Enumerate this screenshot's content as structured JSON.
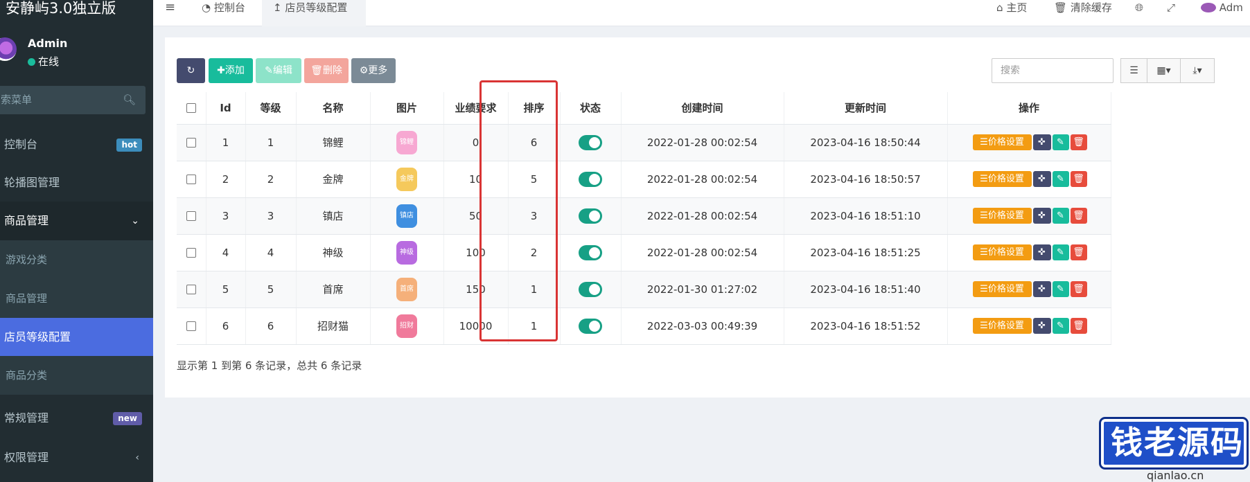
{
  "app": {
    "title": "安静屿3.0独立版"
  },
  "user": {
    "name": "Admin",
    "status": "在线"
  },
  "sidebar": {
    "search_placeholder": "索菜单",
    "items": [
      {
        "label": "控制台",
        "badge": "hot"
      },
      {
        "label": "轮播图管理"
      },
      {
        "label": "商品管理"
      },
      {
        "label": "游戏分类"
      },
      {
        "label": "商品管理"
      },
      {
        "label": "店员等级配置"
      },
      {
        "label": "商品分类"
      },
      {
        "label": "常规管理",
        "badge": "new"
      },
      {
        "label": "权限管理"
      }
    ]
  },
  "topbar": {
    "menu_icon": "≡",
    "tab_dashboard": "控制台",
    "tab_current": "店员等级配置",
    "home": "主页",
    "clear_cache": "清除缓存",
    "admin": "Adm"
  },
  "toolbar": {
    "add": "添加",
    "edit": "编辑",
    "delete": "删除",
    "more": "更多",
    "search_placeholder": "搜索"
  },
  "table": {
    "headers": [
      "Id",
      "等级",
      "名称",
      "图片",
      "业绩要求",
      "排序",
      "状态",
      "创建时间",
      "更新时间",
      "操作"
    ],
    "price_label": "价格设置",
    "rows": [
      {
        "id": "1",
        "level": "1",
        "name": "锦鲤",
        "img_text": "锦鲤",
        "img_color": "#f7a8d2",
        "perf": "0",
        "sort": "6",
        "created": "2022-01-28 00:02:54",
        "updated": "2023-04-16 18:50:44"
      },
      {
        "id": "2",
        "level": "2",
        "name": "金牌",
        "img_text": "金牌",
        "img_color": "#f5c95c",
        "perf": "10",
        "sort": "5",
        "created": "2022-01-28 00:02:54",
        "updated": "2023-04-16 18:50:57"
      },
      {
        "id": "3",
        "level": "3",
        "name": "镇店",
        "img_text": "镇店",
        "img_color": "#3f8fe0",
        "perf": "50",
        "sort": "3",
        "created": "2022-01-28 00:02:54",
        "updated": "2023-04-16 18:51:10"
      },
      {
        "id": "4",
        "level": "4",
        "name": "神级",
        "img_text": "神级",
        "img_color": "#b86be0",
        "perf": "100",
        "sort": "2",
        "created": "2022-01-28 00:02:54",
        "updated": "2023-04-16 18:51:25"
      },
      {
        "id": "5",
        "level": "5",
        "name": "首席",
        "img_text": "首席",
        "img_color": "#f5b07a",
        "perf": "150",
        "sort": "1",
        "created": "2022-01-30 01:27:02",
        "updated": "2023-04-16 18:51:40"
      },
      {
        "id": "6",
        "level": "6",
        "name": "招财猫",
        "img_text": "招财",
        "img_color": "#f07a9b",
        "perf": "10000",
        "sort": "1",
        "created": "2022-03-03 00:49:39",
        "updated": "2023-04-16 18:51:52"
      }
    ]
  },
  "footer": {
    "summary": "显示第 1 到第 6 条记录，总共 6 条记录"
  },
  "watermark": {
    "text": "钱老源码",
    "url": "qianlao.cn"
  },
  "colors": {
    "sidebar": "#222d32",
    "active": "#4b6ce0",
    "switch_on": "#17a085",
    "highlight": "#d93434"
  }
}
